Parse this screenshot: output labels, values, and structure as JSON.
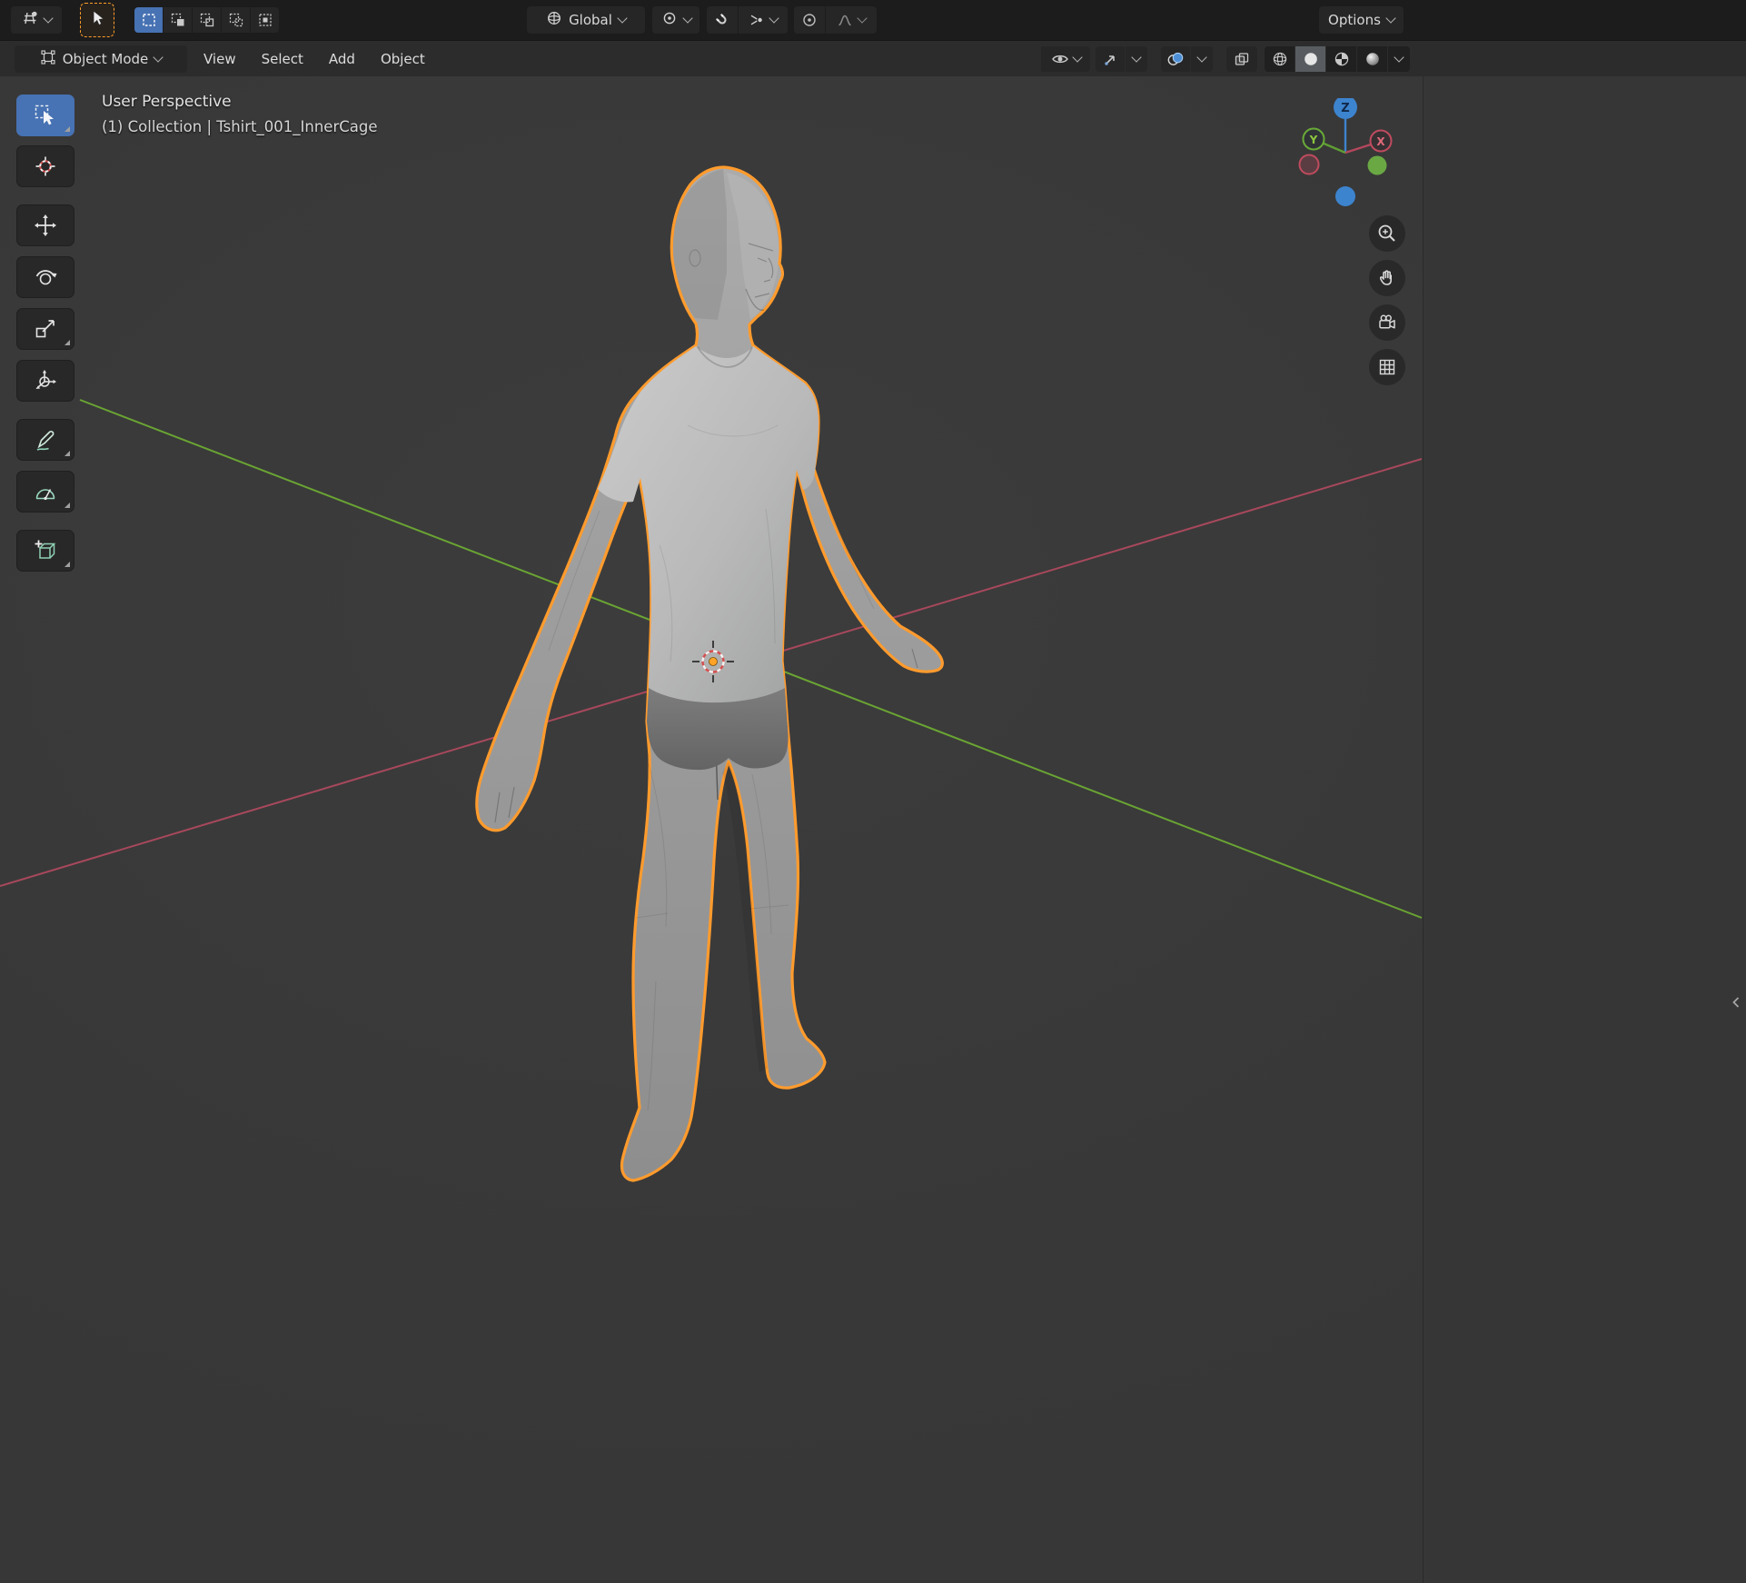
{
  "colors": {
    "accent_blue": "#4772b3",
    "selection_outline": "#ff9b2d",
    "axis_x_red": "#a8485c",
    "axis_y_green": "#6aa433",
    "header_bg": "#1c1c1c",
    "viewport_bg": "#3a3a3a"
  },
  "topbar": {
    "orientation_value": "Global",
    "options_label": "Options"
  },
  "viewport_header": {
    "mode_label": "Object Mode",
    "menus": [
      {
        "label": "View"
      },
      {
        "label": "Select"
      },
      {
        "label": "Add"
      },
      {
        "label": "Object"
      }
    ]
  },
  "viewport": {
    "view_label": "User Perspective",
    "breadcrumb": "(1) Collection | Tshirt_001_InnerCage"
  },
  "nav_gizmo": {
    "x_label": "X",
    "y_label": "Y",
    "z_label": "Z"
  },
  "icons": {
    "editor-type-icon": "perspective-grid-with-sphere",
    "select-box-tool-icon": "cursor-arrow-in-dashed-box",
    "select-mode-new-icon": "dashed-square",
    "select-mode-extend-icon": "dashed-square-plus-solid",
    "select-mode-subtract-icon": "squares-minus",
    "select-mode-invert-icon": "two-dashed-squares",
    "select-mode-intersect-icon": "dashed-square-filled-center",
    "orientation-icon": "globe",
    "pivot-icon": "circle-dot",
    "snap-magnet-icon": "magnet",
    "snap-target-icon": "converging-arrows-dot",
    "proportional-icon": "circle-dot",
    "falloff-icon": "bell-curve",
    "visibility-icon": "eye",
    "gizmos-icon": "diagonal-arrow",
    "overlays-icon": "overlapping-circles",
    "xray-icon": "overlapping-squares",
    "shading-wireframe-icon": "wire-sphere",
    "shading-solid-icon": "solid-sphere",
    "shading-material-icon": "checker-sphere",
    "shading-rendered-icon": "shaded-sphere",
    "zoom-icon": "magnifier-plus",
    "pan-icon": "hand",
    "camera-view-icon": "movie-camera",
    "toggle-ortho-icon": "grid",
    "tool-cursor-icon": "crosshair-dashed-circle",
    "tool-move-icon": "cross-arrows",
    "tool-rotate-icon": "arc-arrow-sphere",
    "tool-scale-icon": "square-diagonal-arrow",
    "tool-transform-icon": "axis-trident-circle",
    "tool-annotate-icon": "pen",
    "tool-measure-icon": "protractor",
    "tool-add-primitive-icon": "cube-plus",
    "collapse-sidebar-icon": "chevron-left",
    "3d-cursor-icon": "red-white-dashed-circle",
    "origin-dot-icon": "orange-dot"
  }
}
